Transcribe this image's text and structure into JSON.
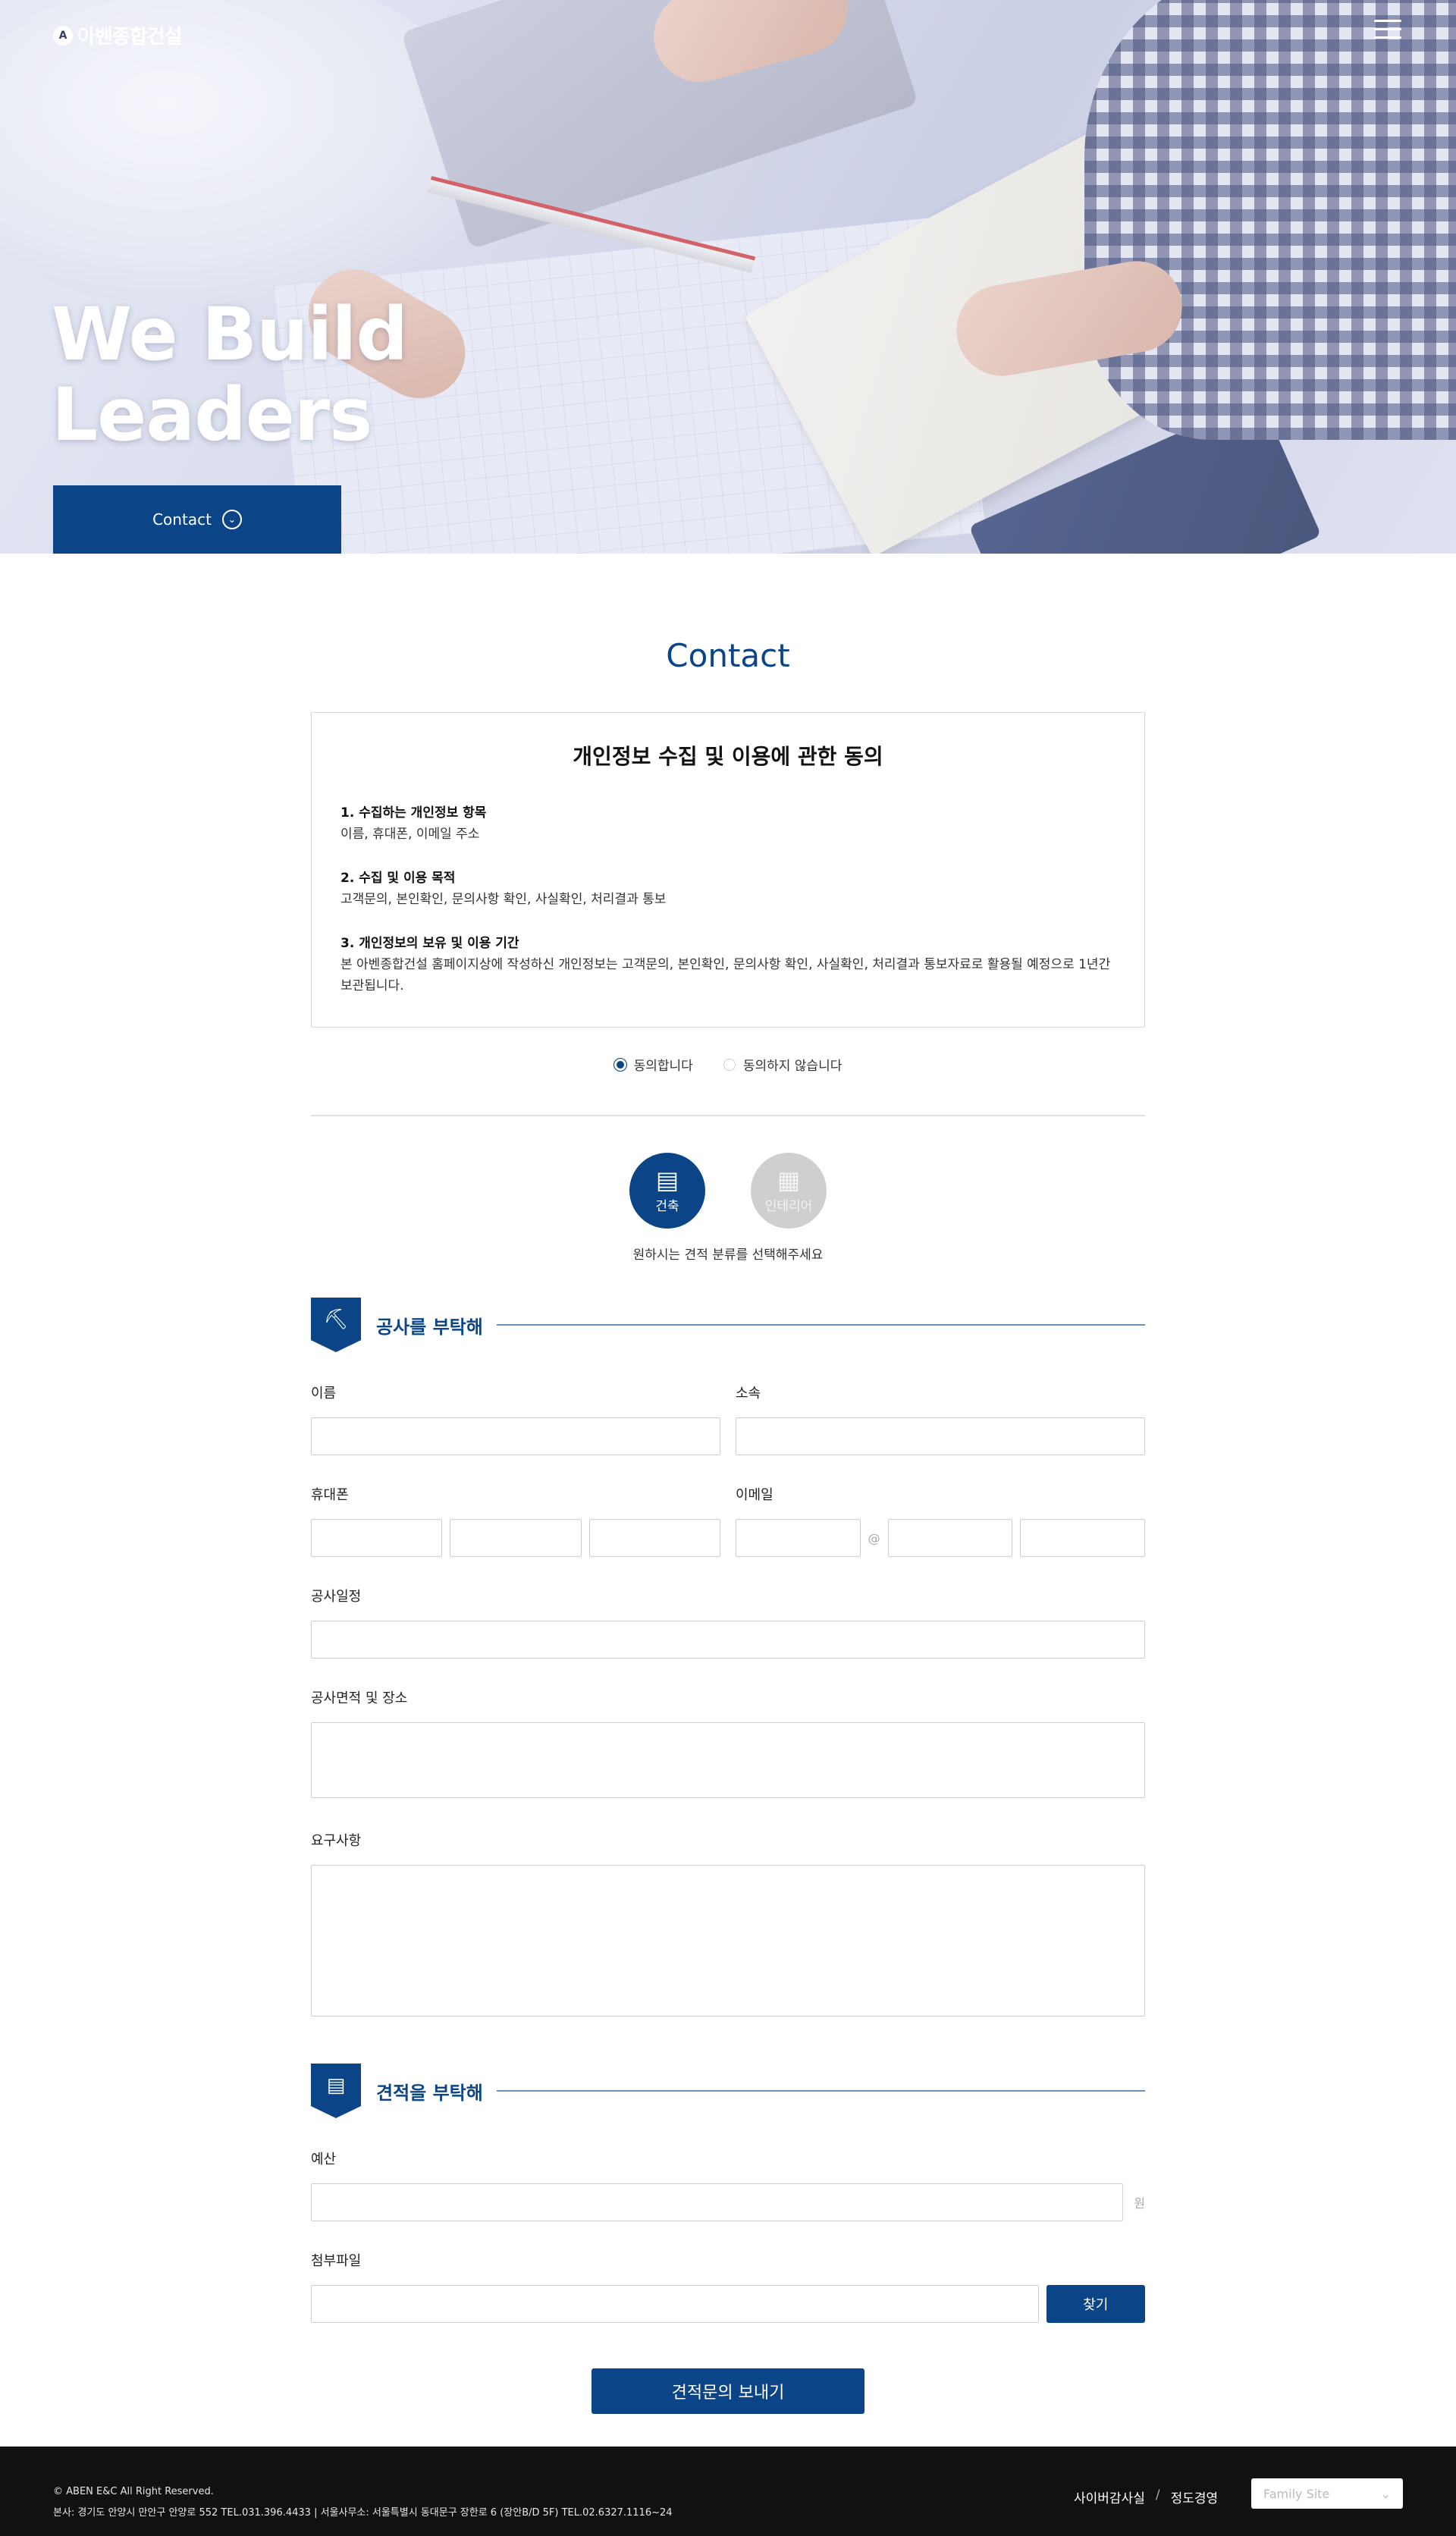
{
  "header": {
    "logo_text": "아벤종합건설",
    "logo_mark": "A"
  },
  "hero": {
    "title_line1": "We Build",
    "title_line2": "Leaders",
    "contact_button": "Contact"
  },
  "contact_title": "Contact",
  "privacy": {
    "title": "개인정보 수집 및 이용에 관한 동의",
    "items": [
      {
        "heading": "1. 수집하는 개인정보 항목",
        "body": "이름, 휴대폰, 이메일 주소"
      },
      {
        "heading": "2. 수집 및 이용 목적",
        "body": "고객문의, 본인확인, 문의사항 확인, 사실확인, 처리결과 통보"
      },
      {
        "heading": "3. 개인정보의 보유 및 이용 기간",
        "body": "본 아벤종합건설 홈페이지상에 작성하신 개인정보는 고객문의, 본인확인, 문의사항 확인, 사실확인, 처리결과 통보자료로 활용될 예정으로 1년간 보관됩니다."
      }
    ],
    "agree_label": "동의합니다",
    "disagree_label": "동의하지 않습니다"
  },
  "category": {
    "options": [
      {
        "label": "건축",
        "icon": "building-crane-icon"
      },
      {
        "label": "인테리어",
        "icon": "interior-icon"
      }
    ],
    "hint": "원하시는 견적 분류를 선택해주세요"
  },
  "section_work": {
    "title": "공사를 부탁해",
    "icon": "helmet-icon",
    "name_label": "이름",
    "company_label": "소속",
    "phone_label": "휴대폰",
    "email_label": "이메일",
    "email_at": "@",
    "schedule_label": "공사일정",
    "area_label": "공사면적 및 장소",
    "request_label": "요구사항"
  },
  "section_estimate": {
    "title": "견적을 부탁해",
    "icon": "document-icon",
    "budget_label": "예산",
    "budget_unit": "원",
    "file_label": "첨부파일",
    "find_button": "찾기"
  },
  "submit_label": "견적문의 보내기",
  "footer": {
    "copyright": "© ABEN E&C All Right Reserved.",
    "address": "본사: 경기도 안양시 만안구 안양로 552  TEL.031.396.4433  |   서울사무소: 서울특별시 동대문구 장한로 6 (장안B/D 5F) TEL.02.6327.1116~24",
    "link1": "사이버감사실",
    "link2": "정도경영",
    "separator": "/",
    "family_site": "Family Site"
  },
  "colors": {
    "primary": "#0b4587",
    "footer_bg": "#111111",
    "inactive": "#cfcfcf"
  }
}
